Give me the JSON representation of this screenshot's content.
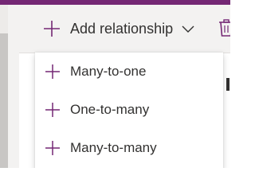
{
  "toolbar": {
    "add_relationship_label": "Add relationship",
    "delete_icon": "trash-icon"
  },
  "menu": {
    "items": [
      {
        "label": "Many-to-one",
        "icon": "plus-icon"
      },
      {
        "label": "One-to-many",
        "icon": "plus-icon"
      },
      {
        "label": "Many-to-many",
        "icon": "plus-icon"
      }
    ]
  },
  "colors": {
    "accent": "#742774",
    "text": "#323130",
    "command_bar_bg": "#f3f2f1",
    "menu_bg": "#ffffff"
  }
}
